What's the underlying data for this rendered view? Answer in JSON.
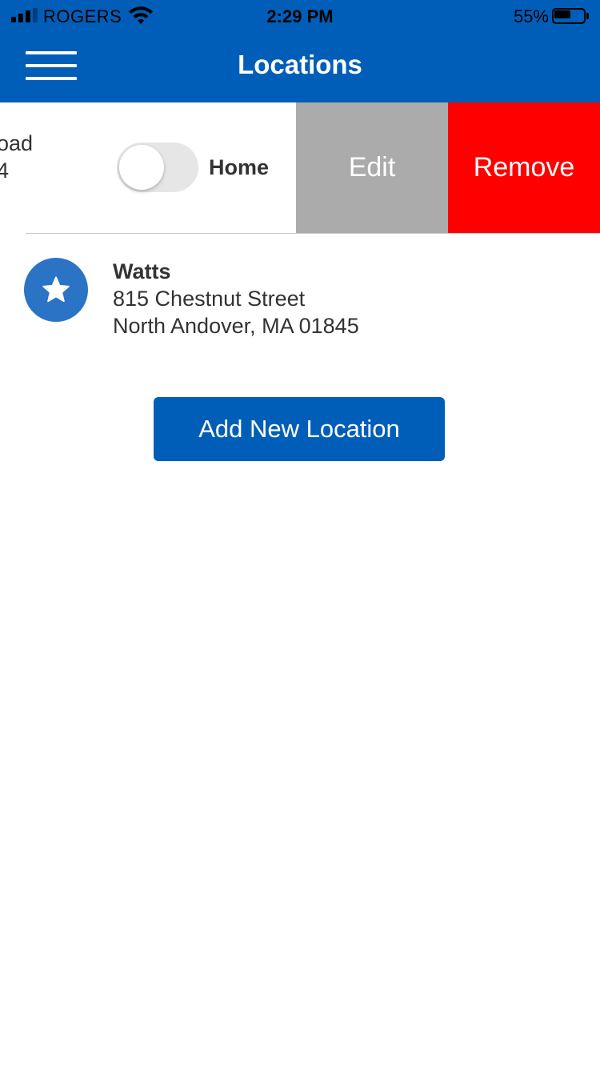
{
  "status_bar": {
    "carrier": "ROGERS",
    "time": "2:29 PM",
    "battery_percent": "55%",
    "battery_level": 0.55,
    "signal_icon": "cellular-signal-icon",
    "wifi_icon": "wifi-icon",
    "battery_icon": "battery-icon"
  },
  "header": {
    "title": "Locations",
    "menu_icon": "hamburger-menu-icon",
    "background_color": "#005EB8"
  },
  "swiped_row": {
    "address_fragment_line1": "oad",
    "address_fragment_line2": "4",
    "toggle_label": "Home",
    "toggle_on": false,
    "edit_label": "Edit",
    "remove_label": "Remove",
    "edit_color": "#ABABAB",
    "remove_color": "#FF0000"
  },
  "locations": [
    {
      "name": "Watts",
      "street": "815 Chestnut Street",
      "city_line": "North Andover, MA 01845",
      "icon": "star-icon",
      "icon_color": "#2A73C5"
    }
  ],
  "actions": {
    "add_location_label": "Add New Location"
  }
}
